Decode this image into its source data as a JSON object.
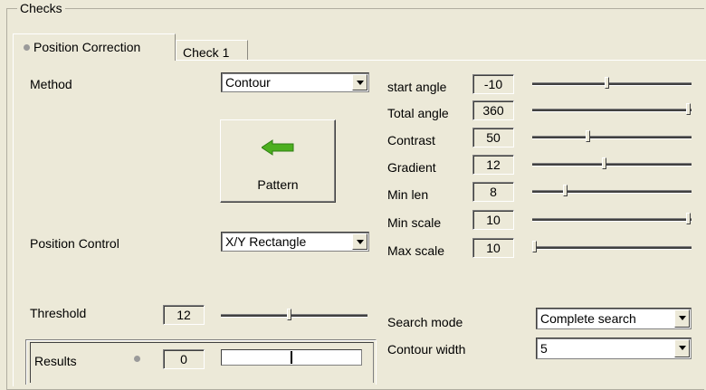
{
  "group": {
    "title": "Checks"
  },
  "tabs": [
    {
      "label": "Position Correction",
      "active": true
    },
    {
      "label": "Check 1",
      "active": false
    }
  ],
  "method": {
    "label": "Method",
    "value": "Contour"
  },
  "pattern_button": {
    "label": "Pattern",
    "icon": "left-arrow-icon",
    "icon_color": "#4caf1f"
  },
  "position_control": {
    "label": "Position Control",
    "value": "X/Y Rectangle"
  },
  "threshold": {
    "label": "Threshold",
    "value": "12",
    "level": 0.47
  },
  "results": {
    "label": "Results",
    "value": "0",
    "progress": 0.5
  },
  "params": [
    {
      "label": "start angle",
      "value": "-10",
      "level": 0.47
    },
    {
      "label": "Total angle",
      "value": "360",
      "level": 1.0
    },
    {
      "label": "Contrast",
      "value": "50",
      "level": 0.35
    },
    {
      "label": "Gradient",
      "value": "12",
      "level": 0.45
    },
    {
      "label": "Min len",
      "value": "8",
      "level": 0.2
    },
    {
      "label": "Min scale",
      "value": "10",
      "level": 1.0
    },
    {
      "label": "Max scale",
      "value": "10",
      "level": 0.0
    }
  ],
  "search_mode": {
    "label": "Search mode",
    "value": "Complete search"
  },
  "contour_width": {
    "label": "Contour width",
    "value": "5"
  }
}
